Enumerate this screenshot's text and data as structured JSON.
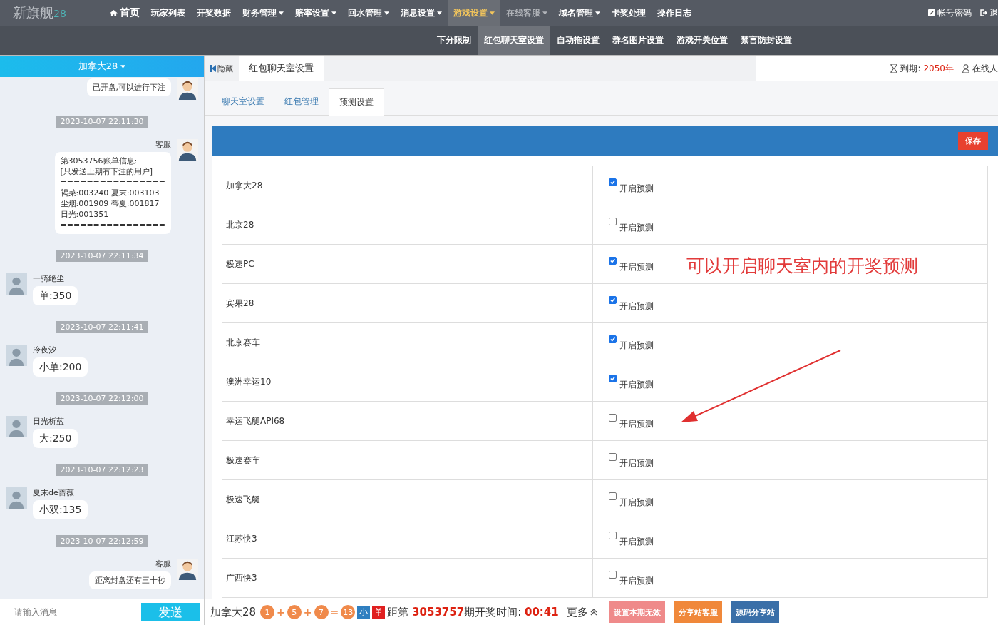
{
  "brand": {
    "name": "新旗舰",
    "suffix": "28"
  },
  "nav": [
    {
      "label": "首页",
      "kind": "home",
      "dropdown": false,
      "selected": false,
      "disabled": false
    },
    {
      "label": "玩家列表",
      "kind": "plain",
      "dropdown": false,
      "selected": false,
      "disabled": false
    },
    {
      "label": "开奖数据",
      "kind": "plain",
      "dropdown": false,
      "selected": false,
      "disabled": false
    },
    {
      "label": "财务管理",
      "kind": "plain",
      "dropdown": true,
      "selected": false,
      "disabled": false
    },
    {
      "label": "赔率设置",
      "kind": "plain",
      "dropdown": true,
      "selected": false,
      "disabled": false
    },
    {
      "label": "回水管理",
      "kind": "plain",
      "dropdown": true,
      "selected": false,
      "disabled": false
    },
    {
      "label": "消息设置",
      "kind": "plain",
      "dropdown": true,
      "selected": false,
      "disabled": false
    },
    {
      "label": "游戏设置",
      "kind": "plain",
      "dropdown": true,
      "selected": true,
      "disabled": false
    },
    {
      "label": "在线客服",
      "kind": "plain",
      "dropdown": true,
      "selected": false,
      "disabled": true
    },
    {
      "label": "域名管理",
      "kind": "plain",
      "dropdown": true,
      "selected": false,
      "disabled": false
    },
    {
      "label": "卡奖处理",
      "kind": "plain",
      "dropdown": false,
      "selected": false,
      "disabled": false
    },
    {
      "label": "操作日志",
      "kind": "plain",
      "dropdown": false,
      "selected": false,
      "disabled": false
    }
  ],
  "account": {
    "password": "帐号密码",
    "logout": "退"
  },
  "subnav": [
    {
      "label": "下分限制",
      "selected": false
    },
    {
      "label": "红包聊天室设置",
      "selected": true
    },
    {
      "label": "自动拖设置",
      "selected": false
    },
    {
      "label": "群名图片设置",
      "selected": false
    },
    {
      "label": "游戏开关位置",
      "selected": false
    },
    {
      "label": "禁言防封设置",
      "selected": false
    }
  ],
  "chat": {
    "room": "加拿大28",
    "messages": [
      {
        "kind": "sent",
        "lines": [
          "已开盘,可以进行下注"
        ]
      },
      {
        "kind": "time",
        "text": "2023-10-07 22:11:30"
      },
      {
        "kind": "sent",
        "sender": "客服",
        "lines": [
          "第3053756账单信息:",
          "[只发送上期有下注的用户]",
          "================",
          "褐菜:003240 夏末:003103",
          "尘烟:001909 蒂夏:001817",
          "日光:001351",
          "================"
        ]
      },
      {
        "kind": "time",
        "text": "2023-10-07 22:11:34"
      },
      {
        "kind": "received",
        "sender": "一骑绝尘",
        "lines": [
          "单:350"
        ]
      },
      {
        "kind": "time",
        "text": "2023-10-07 22:11:41"
      },
      {
        "kind": "received",
        "sender": "冷夜汐",
        "lines": [
          "小单:200"
        ]
      },
      {
        "kind": "time",
        "text": "2023-10-07 22:12:00"
      },
      {
        "kind": "received",
        "sender": "日光析蓝",
        "lines": [
          "大:250"
        ]
      },
      {
        "kind": "time",
        "text": "2023-10-07 22:12:23"
      },
      {
        "kind": "received",
        "sender": "夏末de蔷薇",
        "lines": [
          "小双:135"
        ]
      },
      {
        "kind": "time",
        "text": "2023-10-07 22:12:59"
      },
      {
        "kind": "sent",
        "sender": "客服",
        "lines": [
          "距离封盘还有三十秒"
        ]
      }
    ],
    "input_placeholder": "请输入消息",
    "send": "发送"
  },
  "header": {
    "hide": "隐藏",
    "page_tab": "红包聊天室设置",
    "expire_label": "到期:",
    "expire_value": "2050年",
    "online": "在线人"
  },
  "tabs": [
    {
      "label": "聊天室设置",
      "selected": false
    },
    {
      "label": "红包管理",
      "selected": false
    },
    {
      "label": "预测设置",
      "selected": true
    }
  ],
  "save": "保存",
  "games": [
    {
      "name": "加拿大28",
      "label": "开启预测",
      "checked": true
    },
    {
      "name": "北京28",
      "label": "开启预测",
      "checked": false
    },
    {
      "name": "极速PC",
      "label": "开启预测",
      "checked": true
    },
    {
      "name": "宾果28",
      "label": "开启预测",
      "checked": true
    },
    {
      "name": "北京赛车",
      "label": "开启预测",
      "checked": true
    },
    {
      "name": "澳洲幸运10",
      "label": "开启预测",
      "checked": true
    },
    {
      "name": "幸运飞艇API68",
      "label": "开启预测",
      "checked": false
    },
    {
      "name": "极速赛车",
      "label": "开启预测",
      "checked": false
    },
    {
      "name": "极速飞艇",
      "label": "开启预测",
      "checked": false
    },
    {
      "name": "江苏快3",
      "label": "开启预测",
      "checked": false
    },
    {
      "name": "广西快3",
      "label": "开启预测",
      "checked": false
    }
  ],
  "annotation": "可以开启聊天室内的开奖预测",
  "status": {
    "game": "加拿大28",
    "result": [
      {
        "kind": "ball",
        "text": "1"
      },
      {
        "kind": "op",
        "text": "+"
      },
      {
        "kind": "ball",
        "text": "5"
      },
      {
        "kind": "op",
        "text": "+"
      },
      {
        "kind": "ball",
        "text": "7"
      },
      {
        "kind": "op",
        "text": "="
      },
      {
        "kind": "ball",
        "text": "13"
      },
      {
        "kind": "tag",
        "text": "小",
        "color": "#2f7fc0"
      },
      {
        "kind": "tag",
        "text": "单",
        "color": "#e02020"
      }
    ],
    "prefix": "距第",
    "period": "3053757",
    "suffix": "期开奖时间:",
    "countdown": "00:41",
    "more": "更多",
    "buttons": [
      {
        "label": "设置本期无效",
        "color": "#ef8a8a"
      },
      {
        "label": "分享站客服",
        "color": "#f0883a"
      },
      {
        "label": "源码分享站",
        "color": "#3a6fa8"
      }
    ]
  }
}
